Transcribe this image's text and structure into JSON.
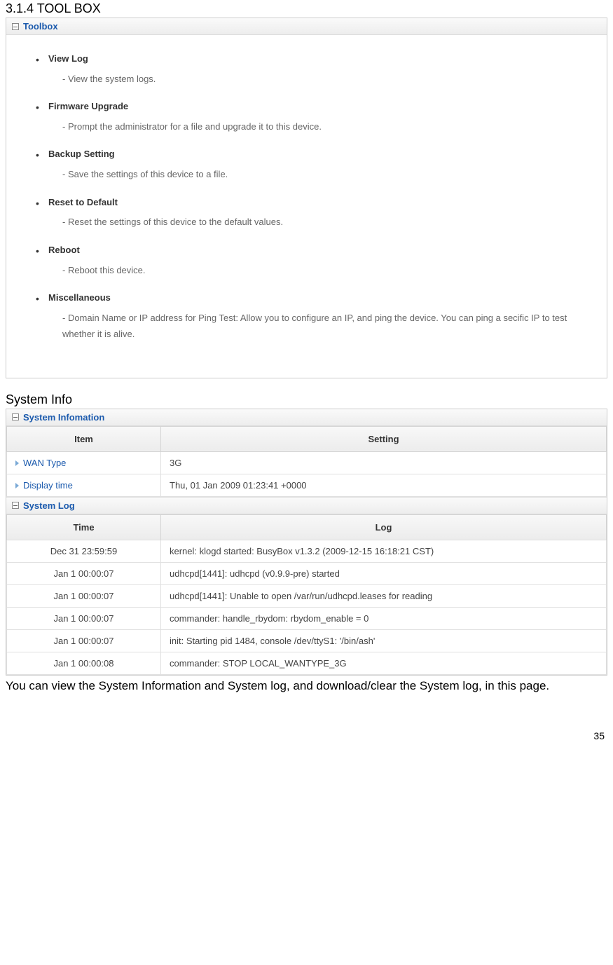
{
  "section_heading_1": "3.1.4 TOOL BOX",
  "toolbox": {
    "panel_title": "Toolbox",
    "items": [
      {
        "title": "View Log",
        "desc": "- View the system logs."
      },
      {
        "title": "Firmware Upgrade",
        "desc": "- Prompt the administrator for a file and upgrade it to this device."
      },
      {
        "title": "Backup Setting",
        "desc": "- Save the settings of this device to a file."
      },
      {
        "title": "Reset to Default",
        "desc": "- Reset the settings of this device to the default values."
      },
      {
        "title": "Reboot",
        "desc": "- Reboot this device."
      },
      {
        "title": "Miscellaneous",
        "desc": "- Domain Name or IP address for Ping Test: Allow you to configure an IP, and ping the device. You can ping a secific IP to test whether it is alive."
      }
    ]
  },
  "section_heading_2": "System Info",
  "sysinfo": {
    "panel_title": "System Infomation",
    "head_item": "Item",
    "head_setting": "Setting",
    "rows": [
      {
        "label": "WAN Type",
        "value": "3G"
      },
      {
        "label": "Display time",
        "value": "Thu, 01 Jan 2009 01:23:41 +0000"
      }
    ]
  },
  "syslog": {
    "panel_title": "System Log",
    "head_time": "Time",
    "head_log": "Log",
    "rows": [
      {
        "time": "Dec 31 23:59:59",
        "log": "kernel: klogd started: BusyBox v1.3.2 (2009-12-15 16:18:21 CST)"
      },
      {
        "time": "Jan 1 00:00:07",
        "log": "udhcpd[1441]: udhcpd (v0.9.9-pre) started"
      },
      {
        "time": "Jan 1 00:00:07",
        "log": "udhcpd[1441]: Unable to open /var/run/udhcpd.leases for reading"
      },
      {
        "time": "Jan 1 00:00:07",
        "log": "commander: handle_rbydom: rbydom_enable = 0"
      },
      {
        "time": "Jan 1 00:00:07",
        "log": "init: Starting pid 1484, console /dev/ttyS1: '/bin/ash'"
      },
      {
        "time": "Jan 1 00:00:08",
        "log": "commander: STOP LOCAL_WANTYPE_3G"
      }
    ]
  },
  "page_note": "You can view the System Information and System log, and download/clear the System log, in this page.",
  "page_number": "35"
}
